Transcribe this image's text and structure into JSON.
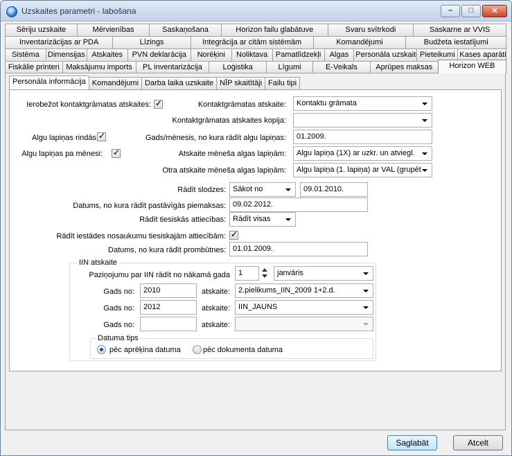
{
  "window": {
    "title": "Uzskaites parametri - labošana",
    "minimize": "–",
    "maximize": "□",
    "close": "✕"
  },
  "tab_rows": [
    [
      "Sēriju uzskaite",
      "Mērvienības",
      "Saskaņošana",
      "Horizon failu glabātuve",
      "Svaru svītrkodi",
      "Saskarne ar VVIS"
    ],
    [
      "Inventarizācijas ar PDA",
      "Līzings",
      "Integrācija ar citām sistēmām",
      "Komandējumi",
      "Budžeta iestatījumi"
    ],
    [
      "Sistēma",
      "Dimensijas",
      "Atskaites",
      "PVN deklarācija",
      "Norēķini",
      "Noliktava",
      "Pamatlīdzekļi",
      "Algas",
      "Personāla uzskaite",
      "Pieteikumi",
      "Kases aparāti"
    ],
    [
      "Fiskālie printeri",
      "Maksājumu imports",
      "PL inventarizācija",
      "Loģistika",
      "Līgumi",
      "E-Veikals",
      "Aprūpes maksas",
      "Horizon WEB"
    ]
  ],
  "inner_tabs": [
    "Personāla informācija",
    "Komandējumi",
    "Darba laika uzskaite",
    "NĪP skaitītāji",
    "Failu tipi"
  ],
  "form": {
    "limit_contact_reports_label": "Ierobežot kontaktgrāmatas atskaites:",
    "limit_contact_reports_checked": true,
    "contact_report_label": "Kontaktgrāmatas atskaite:",
    "contact_report_value": "Kontaktu grāmata",
    "contact_report_copy_label": "Kontaktgrāmatas atskaites kopija:",
    "contact_report_copy_value": "",
    "payslip_rows_label": "Algu lapiņas rindās:",
    "payslip_rows_checked": true,
    "year_month_label": "Gads/mēnesis, no kura rādīt algu lapiņas:",
    "year_month_value": "01.2009.",
    "payslip_month_label": "Algu lapiņas pa mēnesi:",
    "payslip_month_checked": true,
    "monthly_report_label": "Atskaite mēneša algas lapiņām:",
    "monthly_report_value": "Algu lapiņa (1X) ar uzkr. un atviegl.",
    "monthly_report2_label": "Otra atskaite mēneša algas lapiņām:",
    "monthly_report2_value": "Algu lapiņa (1. lapiņa) ar VAL (grupēt",
    "show_deductions_label": "Rādīt slodzes:",
    "show_deductions_value": "Sākot no",
    "show_deductions_date": "09.01.2010.",
    "permanent_notes_date_label": "Datums, no kura rādīt pastāvīgās piemaksas:",
    "permanent_notes_date_value": "09.02.2012.",
    "show_legal_label": "Rādīt tiesiskās attiecības:",
    "show_legal_value": "Rādīt visas",
    "show_institution_names_label": "Rādīt iestādes nosaukumu tiesiskajām attiecībām:",
    "show_institution_names_checked": true,
    "bonus_date_label": "Datums, no kura rādīt prombūtnes:",
    "bonus_date_value": "01.01.2009."
  },
  "iin": {
    "group_title": "IIN atskaite",
    "notice_label": "Paziņojumu par IIN rādīt no nākamā gada",
    "notice_value": "1",
    "notice_month": "janvāris",
    "rows": [
      {
        "year_label": "Gads no:",
        "year": "2010",
        "report_label": "atskaite:",
        "report": "2.pielikums_IIN_2009 1+2.d."
      },
      {
        "year_label": "Gads no:",
        "year": "2012",
        "report_label": "atskaite:",
        "report": "IIN_JAUNS"
      },
      {
        "year_label": "Gads no:",
        "year": "",
        "report_label": "atskaite:",
        "report": ""
      }
    ],
    "date_type_title": "Datuma tips",
    "radio_calc": "pēc aprēķina datuma",
    "radio_calc_selected": true,
    "radio_doc": "pēc dokumenta datuma"
  },
  "buttons": {
    "save": "Saglabāt",
    "cancel": "Atcelt"
  },
  "icons": {
    "check": "✓"
  }
}
